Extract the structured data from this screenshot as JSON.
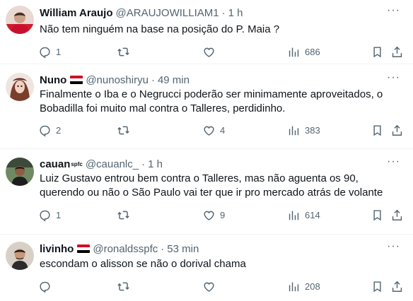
{
  "tweets": [
    {
      "name": "William Araujo",
      "handle": "@ARAUJOWILLIAM1",
      "time": "1 h",
      "text": "Não tem ninguém na base na posição do P. Maia ?",
      "replies": "1",
      "retweets": "",
      "likes": "",
      "views": "686"
    },
    {
      "name": "Nuno",
      "handle": "@nunoshiryu",
      "time": "49 min",
      "text": "Finalmente o Iba e o Negrucci poderão ser minimamente aproveitados, o Bobadilla foi muito mal contra o Talleres, perdidinho.",
      "replies": "2",
      "retweets": "",
      "likes": "4",
      "views": "383"
    },
    {
      "name": "cauan",
      "name_sup": "spfc",
      "handle": "@cauanlc_",
      "time": "1 h",
      "text": "Luiz Gustavo entrou bem contra o Talleres, mas não aguenta os 90, querendo ou não o São Paulo vai ter que ir pro mercado atrás de volante",
      "replies": "1",
      "retweets": "",
      "likes": "9",
      "views": "614"
    },
    {
      "name": "livinho",
      "handle": "@ronaldsspfc",
      "time": "53 min",
      "text": "escondam o alisson se não o dorival chama",
      "replies": "",
      "retweets": "",
      "likes": "",
      "views": "208"
    }
  ],
  "separator": "·",
  "more_glyph": "···",
  "colors": {
    "text": "#0f1419",
    "secondary": "#536471",
    "divider": "#eff3f4",
    "flag_red": "#ce1126",
    "flag_white": "#ffffff",
    "flag_black": "#000000"
  },
  "icons": [
    "reply-icon",
    "retweet-icon",
    "like-icon",
    "views-icon",
    "bookmark-icon",
    "share-icon",
    "more-icon",
    "flag-icon"
  ]
}
